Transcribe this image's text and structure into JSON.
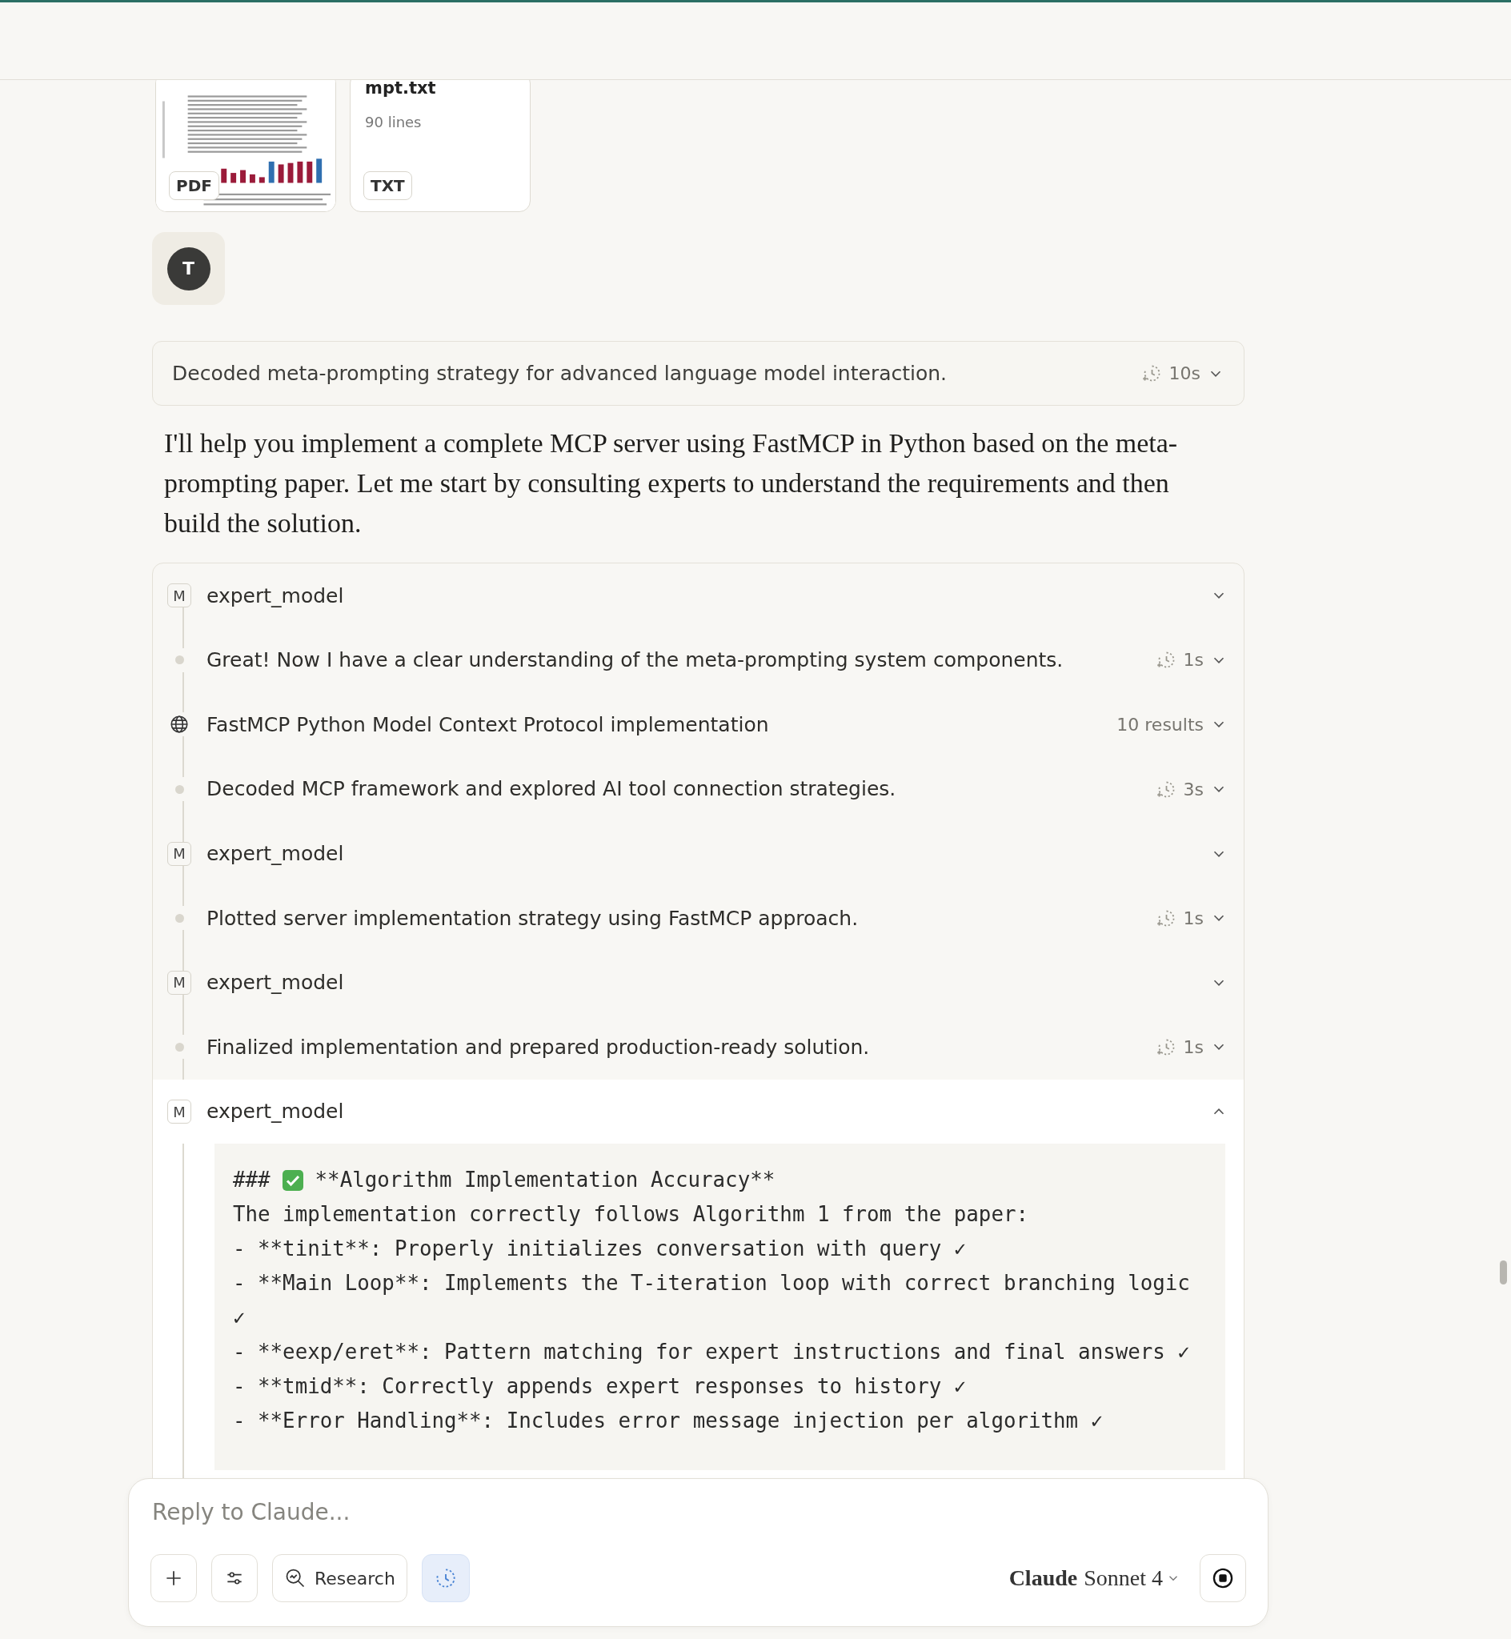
{
  "attachments": [
    {
      "kind": "pdf",
      "badge": "PDF"
    },
    {
      "kind": "txt",
      "name": "mpt.txt",
      "lines": "90 lines",
      "badge": "TXT"
    }
  ],
  "user": {
    "avatar": "T"
  },
  "thinking": {
    "text": "Decoded meta-prompting strategy for advanced language model interaction.",
    "duration": "10s",
    "expanded": false
  },
  "response": "I'll help you implement a complete MCP server using FastMCP in Python based on the meta-prompting paper. Let me start by consulting experts to understand the requirements and then build the solution.",
  "steps": [
    {
      "kind": "model",
      "badge": "M",
      "title": "expert_model",
      "expanded": false
    },
    {
      "kind": "thought",
      "title": "Great! Now I have a clear understanding of the meta-prompting system components.",
      "duration": "1s",
      "expanded": false
    },
    {
      "kind": "search",
      "title": "FastMCP Python Model Context Protocol implementation",
      "results": "10 results",
      "expanded": false
    },
    {
      "kind": "thought",
      "title": "Decoded MCP framework and explored AI tool connection strategies.",
      "duration": "3s",
      "expanded": false
    },
    {
      "kind": "model",
      "badge": "M",
      "title": "expert_model",
      "expanded": false
    },
    {
      "kind": "thought",
      "title": "Plotted server implementation strategy using FastMCP approach.",
      "duration": "1s",
      "expanded": false
    },
    {
      "kind": "model",
      "badge": "M",
      "title": "expert_model",
      "expanded": false
    },
    {
      "kind": "thought",
      "title": "Finalized implementation and prepared production-ready solution.",
      "duration": "1s",
      "expanded": false
    },
    {
      "kind": "model",
      "badge": "M",
      "title": "expert_model",
      "expanded": true,
      "output": [
        {
          "kind": "heading",
          "marker": "###",
          "check": true,
          "text": "**Algorithm Implementation Accuracy**"
        },
        {
          "kind": "text",
          "text": "The implementation correctly follows Algorithm 1 from the paper:"
        },
        {
          "kind": "text",
          "text": "- **tinit**: Properly initializes conversation with query ✓"
        },
        {
          "kind": "text",
          "text": "- **Main Loop**: Implements the T-iteration loop with correct branching logic ✓"
        },
        {
          "kind": "text",
          "text": "- **eexp/eret**: Pattern matching for expert instructions and final answers ✓"
        },
        {
          "kind": "text",
          "text": "- **tmid**: Correctly appends expert responses to history ✓"
        },
        {
          "kind": "text",
          "text": "- **Error Handling**: Includes error message injection per algorithm ✓"
        }
      ]
    }
  ],
  "composer": {
    "placeholder": "Reply to Claude...",
    "research": "Research",
    "extended_thinking": true,
    "model_brand": "Claude",
    "model_name": "Sonnet 4"
  }
}
